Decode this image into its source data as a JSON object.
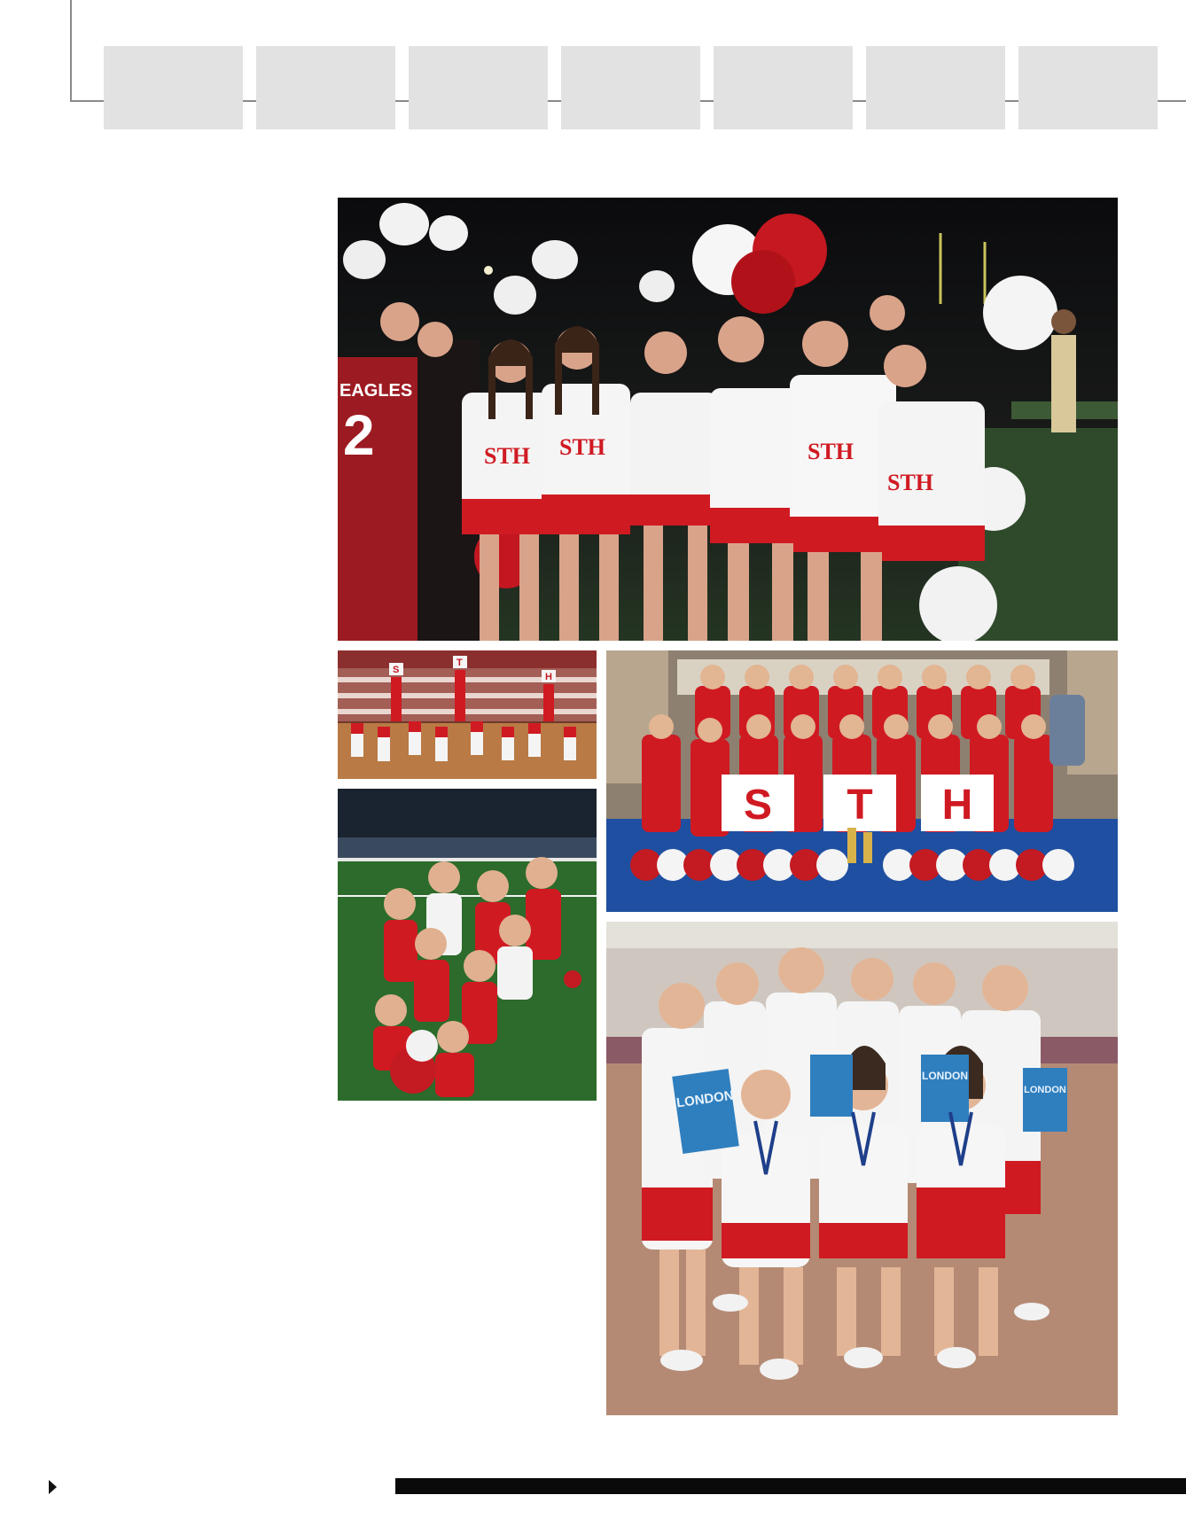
{
  "header": {
    "tabs": [
      "",
      "",
      "",
      "",
      "",
      "",
      ""
    ]
  },
  "photos": [
    {
      "name": "photo-football-cheer-night",
      "subject": "cheerleaders and football players at night game",
      "jersey_text": "EAGLES",
      "jersey_number": "2",
      "uniform_text": "STH"
    },
    {
      "name": "photo-gym-stunt-formation",
      "subject": "cheer stunt formation in gym",
      "sign_letters": [
        "S",
        "T",
        "H"
      ]
    },
    {
      "name": "photo-stadium-field-group",
      "subject": "cheer squad on stadium turf"
    },
    {
      "name": "photo-team-sth-signs",
      "subject": "team posing with STH letter signs",
      "sign_letters": [
        "S",
        "T",
        "H"
      ]
    },
    {
      "name": "photo-london-medals",
      "subject": "cheerleaders with medals and London books",
      "book_text": "LONDON"
    }
  ],
  "colors": {
    "tab_gray": "#e2e2e2",
    "uniform_red": "#d01a22",
    "frame_gray": "#8a8a8a",
    "footer_black": "#0a0a0a"
  }
}
